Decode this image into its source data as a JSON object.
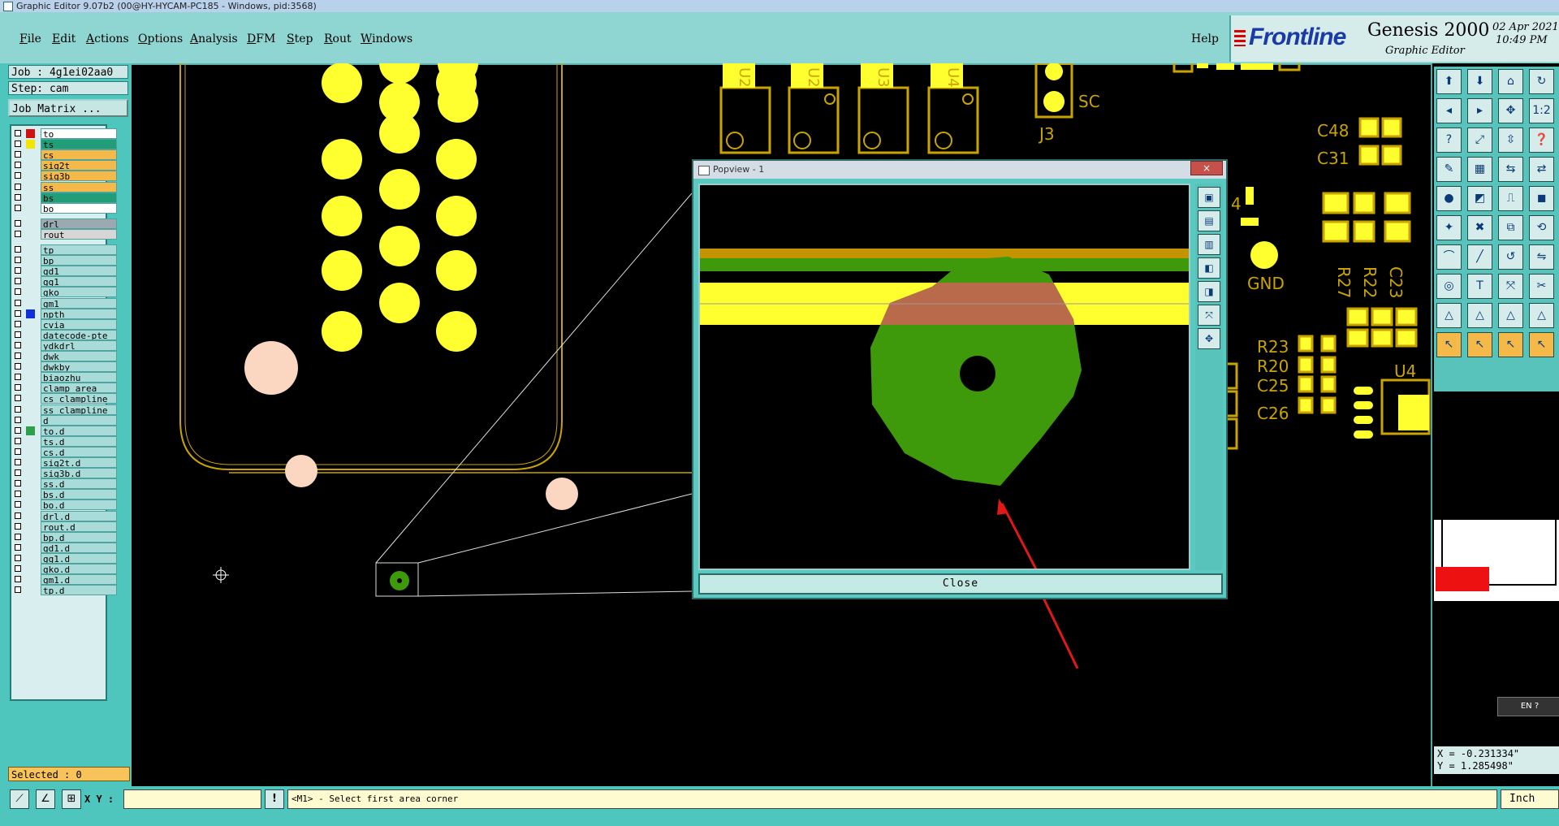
{
  "window_title": "Graphic Editor 9.07b2 (00@HY-HYCAM-PC185 - Windows, pid:3568)",
  "menu": [
    "File",
    "Edit",
    "Actions",
    "Options",
    "Analysis",
    "DFM",
    "Step",
    "Rout",
    "Windows"
  ],
  "help_label": "Help",
  "brand": {
    "logo": "Frontline",
    "product": "Genesis 2000",
    "subtitle": "Graphic Editor",
    "date": "02 Apr 2021",
    "time": "10:49 PM"
  },
  "job_info": {
    "job": "Job : 4g1ei02aa0",
    "step": "Step: cam",
    "matrix_button": "Job Matrix ..."
  },
  "layers": [
    {
      "name": "to",
      "color": "#ffffff",
      "swatch": "#d01010"
    },
    {
      "name": "ts",
      "color": "#1f9e77",
      "swatch": "#f2e600"
    },
    {
      "name": "cs",
      "color": "#f5b94a",
      "swatch": null
    },
    {
      "name": "sig2t",
      "color": "#f5b94a",
      "swatch": null
    },
    {
      "name": "sig3b",
      "color": "#f5b94a",
      "swatch": null
    },
    {
      "name": "ss",
      "color": "#f5b94a",
      "swatch": null
    },
    {
      "name": "bs",
      "color": "#1f9e77",
      "swatch": null
    },
    {
      "name": "bo",
      "color": "#ffffff",
      "swatch": null
    },
    {
      "name": "drl",
      "color": "#9aaab0",
      "swatch": null
    },
    {
      "name": "rout",
      "color": "#d6d6d6",
      "swatch": null
    },
    {
      "name": "tp",
      "color": null,
      "swatch": null
    },
    {
      "name": "bp",
      "color": null,
      "swatch": null
    },
    {
      "name": "gd1",
      "color": null,
      "swatch": null
    },
    {
      "name": "gg1",
      "color": null,
      "swatch": null
    },
    {
      "name": "gko",
      "color": null,
      "swatch": null
    },
    {
      "name": "gm1",
      "color": null,
      "swatch": null
    },
    {
      "name": "npth",
      "color": null,
      "swatch": "#1030d8"
    },
    {
      "name": "cvia",
      "color": null,
      "swatch": null
    },
    {
      "name": "datecode-pte",
      "color": null,
      "swatch": null
    },
    {
      "name": "ydkdrl",
      "color": null,
      "swatch": null
    },
    {
      "name": "dwk",
      "color": null,
      "swatch": null
    },
    {
      "name": "dwkby",
      "color": null,
      "swatch": null
    },
    {
      "name": "biaozhu",
      "color": null,
      "swatch": null
    },
    {
      "name": "clamp_area",
      "color": null,
      "swatch": null
    },
    {
      "name": "cs_clampline",
      "color": null,
      "swatch": null
    },
    {
      "name": "ss_clampline",
      "color": null,
      "swatch": null
    },
    {
      "name": "d",
      "color": null,
      "swatch": null
    },
    {
      "name": "to.d",
      "color": null,
      "swatch": "#2fa04a"
    },
    {
      "name": "ts.d",
      "color": null,
      "swatch": null
    },
    {
      "name": "cs.d",
      "color": null,
      "swatch": null
    },
    {
      "name": "sig2t.d",
      "color": null,
      "swatch": null
    },
    {
      "name": "sig3b.d",
      "color": null,
      "swatch": null
    },
    {
      "name": "ss.d",
      "color": null,
      "swatch": null
    },
    {
      "name": "bs.d",
      "color": null,
      "swatch": null
    },
    {
      "name": "bo.d",
      "color": null,
      "swatch": null
    },
    {
      "name": "drl.d",
      "color": null,
      "swatch": null
    },
    {
      "name": "rout.d",
      "color": null,
      "swatch": null
    },
    {
      "name": "bp.d",
      "color": null,
      "swatch": null
    },
    {
      "name": "gd1.d",
      "color": null,
      "swatch": null
    },
    {
      "name": "gg1.d",
      "color": null,
      "swatch": null
    },
    {
      "name": "gko.d",
      "color": null,
      "swatch": null
    },
    {
      "name": "gm1.d",
      "color": null,
      "swatch": null
    },
    {
      "name": "tp.d",
      "color": null,
      "swatch": null
    }
  ],
  "selected_text": "Selected : 0",
  "canvas_labels": {
    "u2a": "U2",
    "u2b": "U2",
    "u3": "U3",
    "u4": "U4",
    "sc": "SC",
    "j3": "J3",
    "c48": "C48",
    "c31": "C31",
    "gnd": "GND",
    "r27": "R27",
    "r22": "R22",
    "c23": "C23",
    "r23": "R23",
    "r20": "R20",
    "c25": "C25",
    "c26": "C26",
    "u4b": "U4",
    "four": "4"
  },
  "popview": {
    "title": "Popview - 1",
    "close_x": "×",
    "close_label": "Close"
  },
  "coords": {
    "x": "X = -0.231334\"",
    "y": "Y = 1.285498\""
  },
  "ime_badge": "EN ?",
  "bottom": {
    "xy_label": "X Y :",
    "xy_value": "",
    "bang": "!",
    "message": "<M1> - Select first area corner",
    "unit": "Inch"
  },
  "colors": {
    "pad_yellow": "#ffff30",
    "outline_gold": "#c9a400",
    "green_pad": "#3e9a0a",
    "panel_teal": "#4fc6bd",
    "annotation_red": "#e01818"
  }
}
